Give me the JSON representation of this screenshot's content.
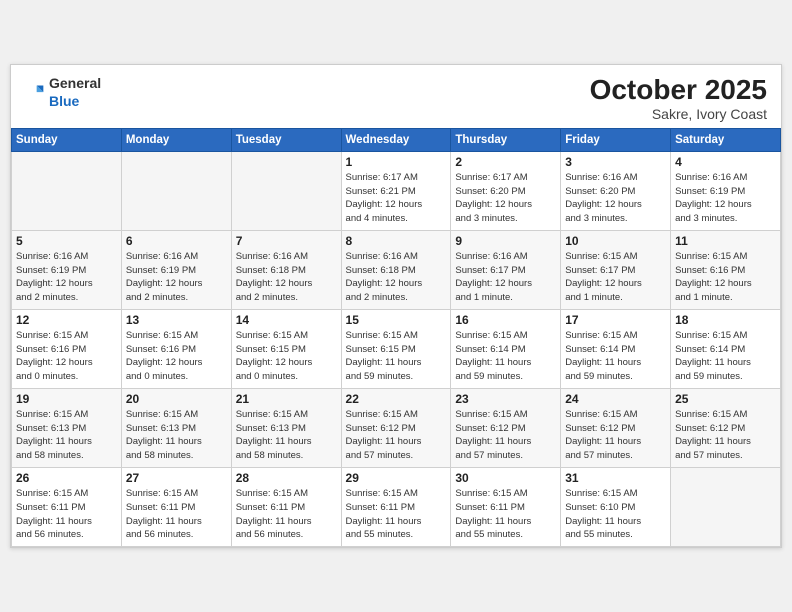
{
  "header": {
    "logo_general": "General",
    "logo_blue": "Blue",
    "month": "October 2025",
    "location": "Sakre, Ivory Coast"
  },
  "weekdays": [
    "Sunday",
    "Monday",
    "Tuesday",
    "Wednesday",
    "Thursday",
    "Friday",
    "Saturday"
  ],
  "weeks": [
    [
      {
        "day": "",
        "info": ""
      },
      {
        "day": "",
        "info": ""
      },
      {
        "day": "",
        "info": ""
      },
      {
        "day": "1",
        "info": "Sunrise: 6:17 AM\nSunset: 6:21 PM\nDaylight: 12 hours\nand 4 minutes."
      },
      {
        "day": "2",
        "info": "Sunrise: 6:17 AM\nSunset: 6:20 PM\nDaylight: 12 hours\nand 3 minutes."
      },
      {
        "day": "3",
        "info": "Sunrise: 6:16 AM\nSunset: 6:20 PM\nDaylight: 12 hours\nand 3 minutes."
      },
      {
        "day": "4",
        "info": "Sunrise: 6:16 AM\nSunset: 6:19 PM\nDaylight: 12 hours\nand 3 minutes."
      }
    ],
    [
      {
        "day": "5",
        "info": "Sunrise: 6:16 AM\nSunset: 6:19 PM\nDaylight: 12 hours\nand 2 minutes."
      },
      {
        "day": "6",
        "info": "Sunrise: 6:16 AM\nSunset: 6:19 PM\nDaylight: 12 hours\nand 2 minutes."
      },
      {
        "day": "7",
        "info": "Sunrise: 6:16 AM\nSunset: 6:18 PM\nDaylight: 12 hours\nand 2 minutes."
      },
      {
        "day": "8",
        "info": "Sunrise: 6:16 AM\nSunset: 6:18 PM\nDaylight: 12 hours\nand 2 minutes."
      },
      {
        "day": "9",
        "info": "Sunrise: 6:16 AM\nSunset: 6:17 PM\nDaylight: 12 hours\nand 1 minute."
      },
      {
        "day": "10",
        "info": "Sunrise: 6:15 AM\nSunset: 6:17 PM\nDaylight: 12 hours\nand 1 minute."
      },
      {
        "day": "11",
        "info": "Sunrise: 6:15 AM\nSunset: 6:16 PM\nDaylight: 12 hours\nand 1 minute."
      }
    ],
    [
      {
        "day": "12",
        "info": "Sunrise: 6:15 AM\nSunset: 6:16 PM\nDaylight: 12 hours\nand 0 minutes."
      },
      {
        "day": "13",
        "info": "Sunrise: 6:15 AM\nSunset: 6:16 PM\nDaylight: 12 hours\nand 0 minutes."
      },
      {
        "day": "14",
        "info": "Sunrise: 6:15 AM\nSunset: 6:15 PM\nDaylight: 12 hours\nand 0 minutes."
      },
      {
        "day": "15",
        "info": "Sunrise: 6:15 AM\nSunset: 6:15 PM\nDaylight: 11 hours\nand 59 minutes."
      },
      {
        "day": "16",
        "info": "Sunrise: 6:15 AM\nSunset: 6:14 PM\nDaylight: 11 hours\nand 59 minutes."
      },
      {
        "day": "17",
        "info": "Sunrise: 6:15 AM\nSunset: 6:14 PM\nDaylight: 11 hours\nand 59 minutes."
      },
      {
        "day": "18",
        "info": "Sunrise: 6:15 AM\nSunset: 6:14 PM\nDaylight: 11 hours\nand 59 minutes."
      }
    ],
    [
      {
        "day": "19",
        "info": "Sunrise: 6:15 AM\nSunset: 6:13 PM\nDaylight: 11 hours\nand 58 minutes."
      },
      {
        "day": "20",
        "info": "Sunrise: 6:15 AM\nSunset: 6:13 PM\nDaylight: 11 hours\nand 58 minutes."
      },
      {
        "day": "21",
        "info": "Sunrise: 6:15 AM\nSunset: 6:13 PM\nDaylight: 11 hours\nand 58 minutes."
      },
      {
        "day": "22",
        "info": "Sunrise: 6:15 AM\nSunset: 6:12 PM\nDaylight: 11 hours\nand 57 minutes."
      },
      {
        "day": "23",
        "info": "Sunrise: 6:15 AM\nSunset: 6:12 PM\nDaylight: 11 hours\nand 57 minutes."
      },
      {
        "day": "24",
        "info": "Sunrise: 6:15 AM\nSunset: 6:12 PM\nDaylight: 11 hours\nand 57 minutes."
      },
      {
        "day": "25",
        "info": "Sunrise: 6:15 AM\nSunset: 6:12 PM\nDaylight: 11 hours\nand 57 minutes."
      }
    ],
    [
      {
        "day": "26",
        "info": "Sunrise: 6:15 AM\nSunset: 6:11 PM\nDaylight: 11 hours\nand 56 minutes."
      },
      {
        "day": "27",
        "info": "Sunrise: 6:15 AM\nSunset: 6:11 PM\nDaylight: 11 hours\nand 56 minutes."
      },
      {
        "day": "28",
        "info": "Sunrise: 6:15 AM\nSunset: 6:11 PM\nDaylight: 11 hours\nand 56 minutes."
      },
      {
        "day": "29",
        "info": "Sunrise: 6:15 AM\nSunset: 6:11 PM\nDaylight: 11 hours\nand 55 minutes."
      },
      {
        "day": "30",
        "info": "Sunrise: 6:15 AM\nSunset: 6:11 PM\nDaylight: 11 hours\nand 55 minutes."
      },
      {
        "day": "31",
        "info": "Sunrise: 6:15 AM\nSunset: 6:10 PM\nDaylight: 11 hours\nand 55 minutes."
      },
      {
        "day": "",
        "info": ""
      }
    ]
  ]
}
